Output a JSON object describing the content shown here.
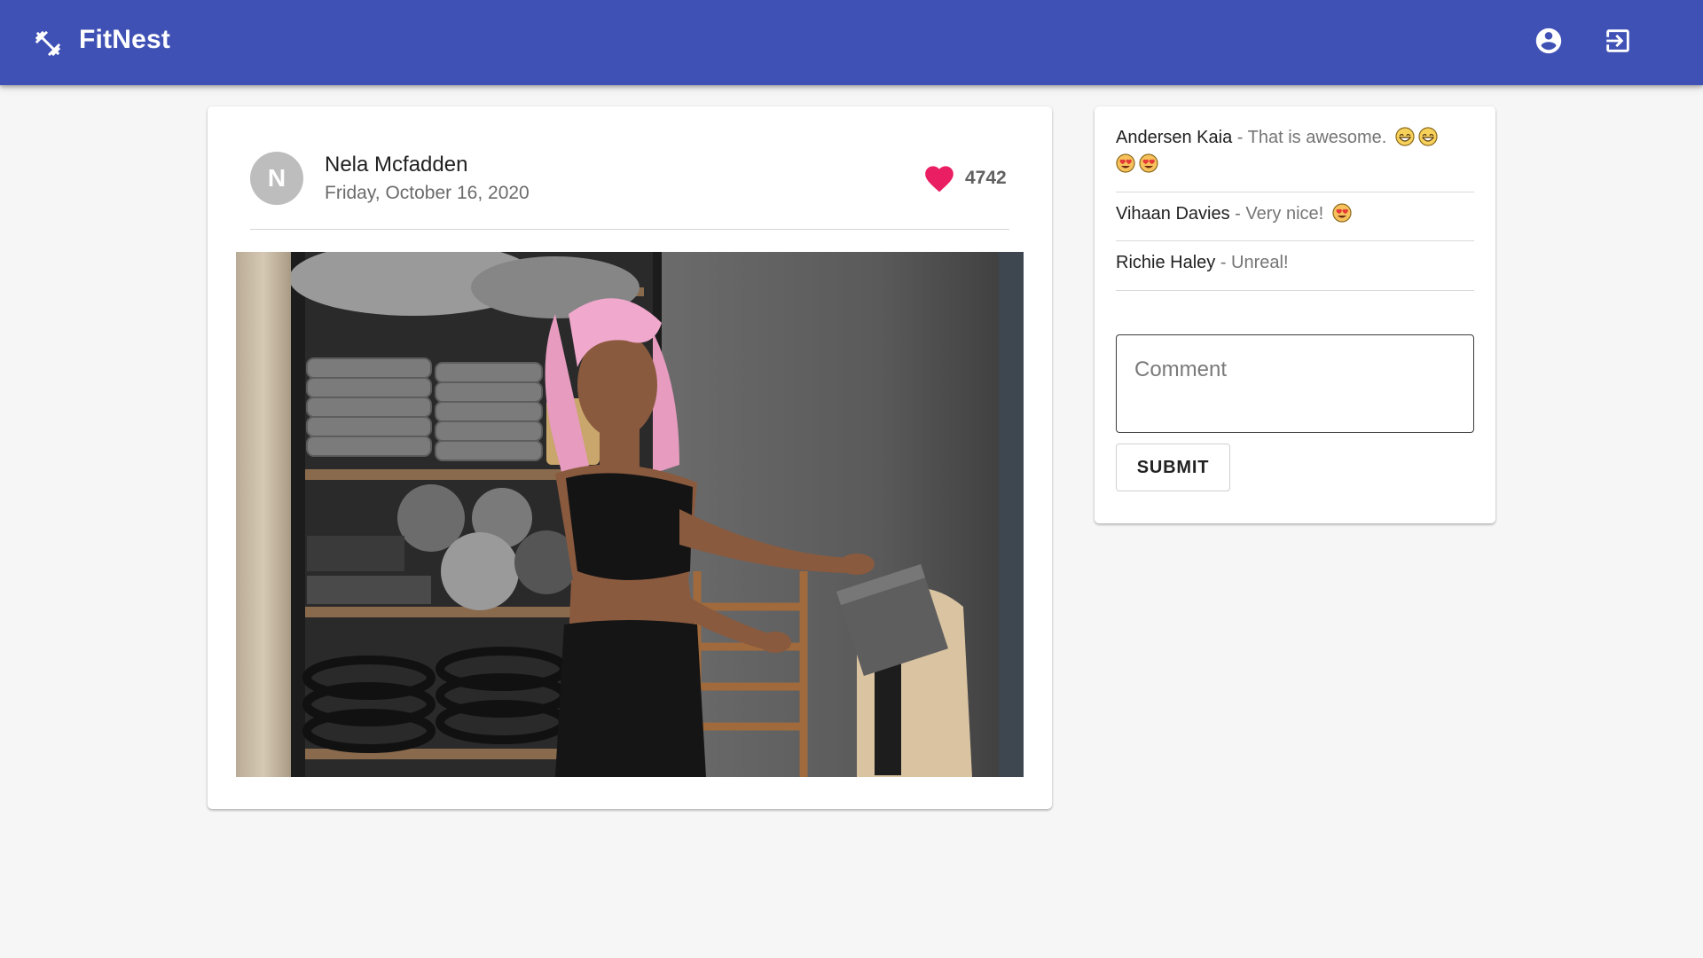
{
  "app": {
    "title": "FitNest",
    "brand_icon": "dumbbell-icon",
    "account_icon": "account-circle-icon",
    "logout_icon": "logout-icon",
    "primary_color": "#3f51b5"
  },
  "post": {
    "avatar_initial": "N",
    "author": "Nela Mcfadden",
    "date": "Friday, October 16, 2020",
    "likes": "4742",
    "like_icon": "heart-icon",
    "like_color": "#e91e63",
    "image_description_icon": "photo"
  },
  "comments": [
    {
      "author": "Andersen Kaia",
      "separator": " - ",
      "text": "That is awesome.",
      "emojis": [
        "grin-emoji",
        "grin-emoji",
        "heart-eyes-emoji",
        "heart-eyes-emoji"
      ]
    },
    {
      "author": "Vihaan Davies",
      "separator": " - ",
      "text": "Very nice!",
      "emojis": [
        "heart-eyes-emoji"
      ]
    },
    {
      "author": "Richie Haley",
      "separator": " - ",
      "text": "Unreal!",
      "emojis": []
    }
  ],
  "comment_form": {
    "placeholder": "Comment",
    "submit_label": "SUBMIT"
  }
}
